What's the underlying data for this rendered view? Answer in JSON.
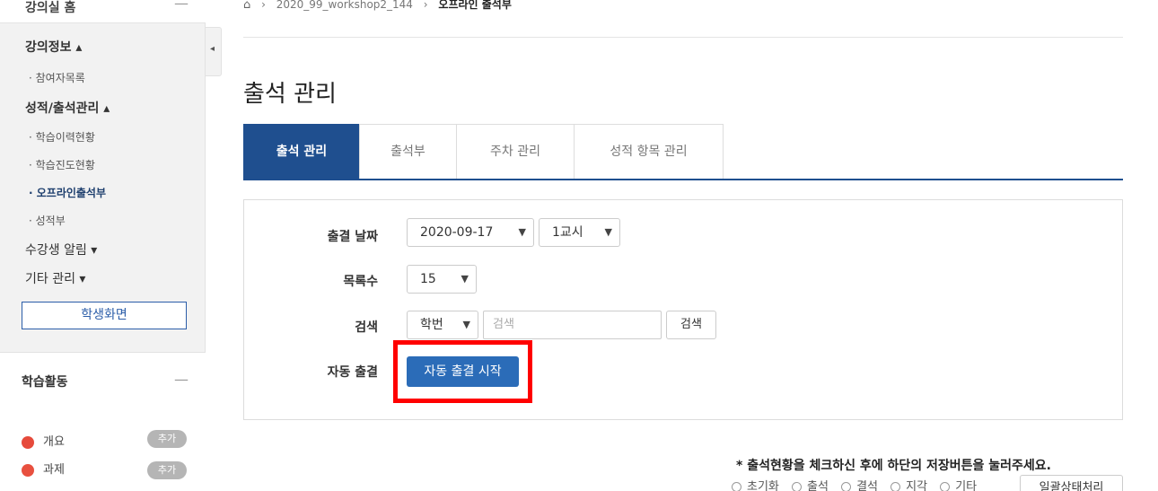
{
  "sidebar": {
    "top_title": "강의실 홈",
    "sections": [
      {
        "label": "강의정보 ▴"
      },
      {
        "label": "· 참여자목록"
      },
      {
        "label": "성적/출석관리 ▴"
      },
      {
        "label": "· 학습이력현황"
      },
      {
        "label": "· 학습진도현황"
      },
      {
        "label": "· 오프라인출석부"
      },
      {
        "label": "· 성적부"
      },
      {
        "label": "수강생 알림 ▾"
      },
      {
        "label": "기타 관리 ▾"
      }
    ],
    "student_view_button": "학생화면",
    "activity": {
      "title": "학습활동",
      "items": [
        {
          "label": "개요",
          "badge": "추가"
        },
        {
          "label": "과제",
          "badge": "추가"
        }
      ]
    }
  },
  "breadcrumb": {
    "course": "2020_99_workshop2_144",
    "current": "오프라인 출석부"
  },
  "page": {
    "title": "출석 관리"
  },
  "tabs": [
    {
      "label": "출석 관리",
      "active": true
    },
    {
      "label": "출석부",
      "active": false
    },
    {
      "label": "주차 관리",
      "active": false
    },
    {
      "label": "성적 항목 관리",
      "active": false
    }
  ],
  "form": {
    "date_label": "출결 날짜",
    "date_value": "2020-09-17",
    "period_value": "1교시",
    "count_label": "목록수",
    "count_value": "15",
    "search_label": "검색",
    "search_field_value": "학번",
    "search_placeholder": "검색",
    "search_button": "검색",
    "auto_label": "자동 출결",
    "auto_button": "자동 출결 시작"
  },
  "notice": "* 출석현황을 체크하신 후에 하단의 저장버튼을 눌러주세요.",
  "bottom": {
    "options": [
      "초기화",
      "출석",
      "결석",
      "지각",
      "기타"
    ],
    "batch_button": "일괄상태처리"
  },
  "colors": {
    "accent": "#1f4f8f",
    "primary_button": "#2b6cb8",
    "highlight": "#ff0000"
  }
}
